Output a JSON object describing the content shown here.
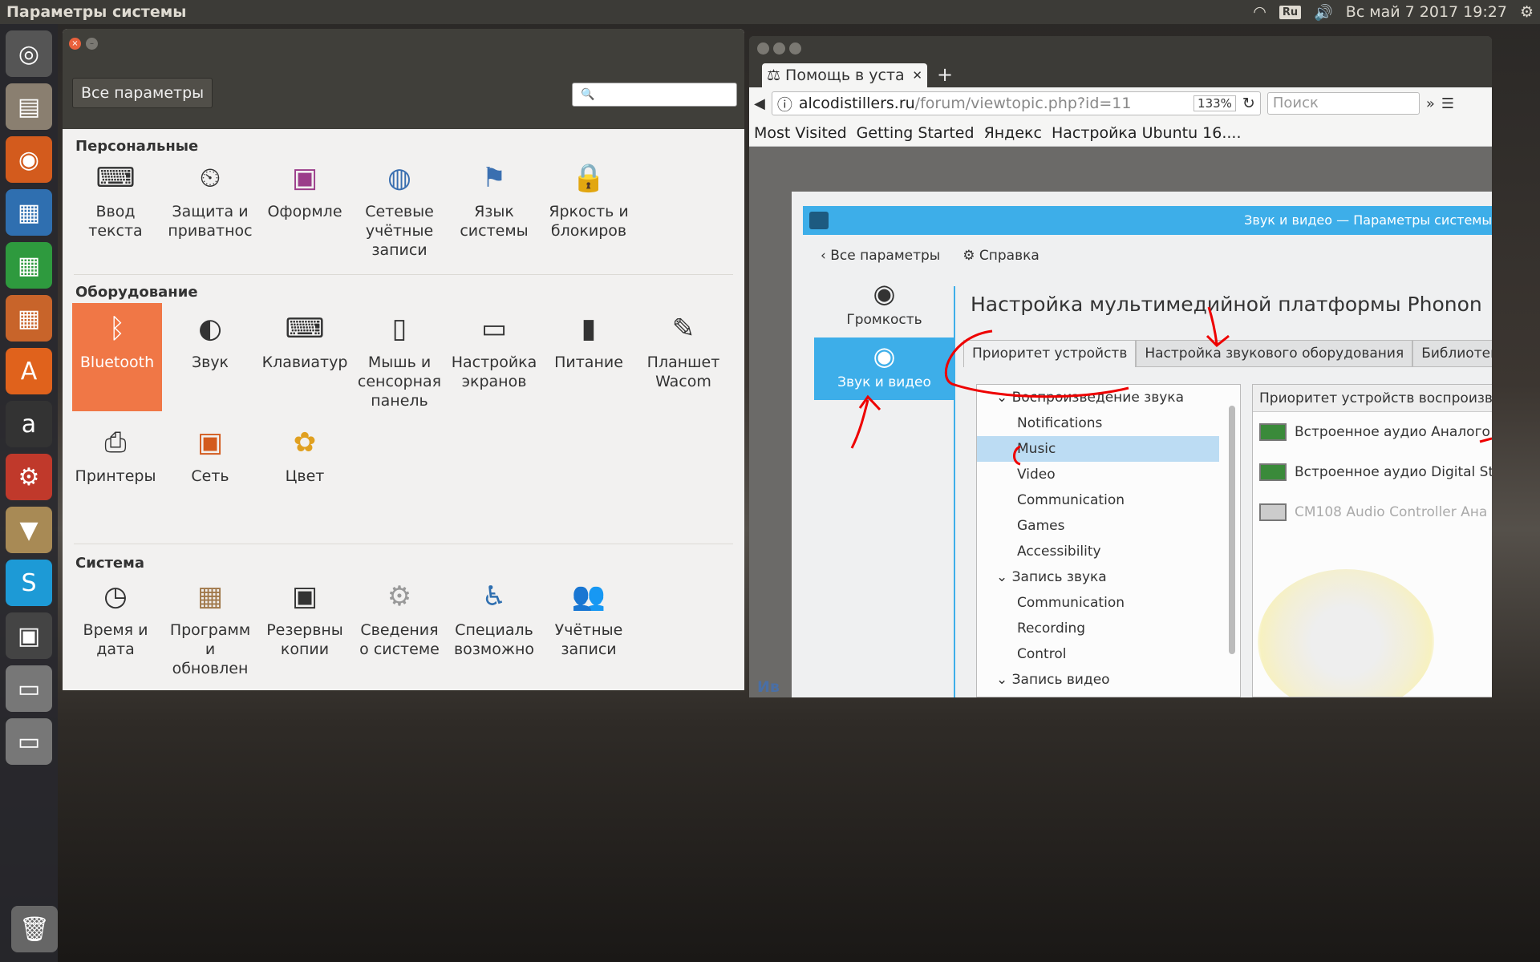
{
  "topbar": {
    "app_title": "Параметры системы",
    "lang": "Ru",
    "datetime": "Вс май  7 2017 19:27"
  },
  "launcher": {
    "items": [
      "ubuntu-icon",
      "files-icon",
      "firefox-icon",
      "writer-icon",
      "calc-icon",
      "impress-icon",
      "software-center-icon",
      "amazon-icon",
      "settings-icon",
      "archive-icon",
      "skype-icon",
      "save-icon",
      "drive-icon",
      "drive-icon"
    ],
    "trash": "trash-icon"
  },
  "settings": {
    "all_button": "Все параметры",
    "sections": {
      "personal": "Персональные",
      "hardware": "Оборудование",
      "system": "Система"
    },
    "personal_items": [
      {
        "label": "Ввод текста",
        "icon": "keyboard-input-icon"
      },
      {
        "label": "Защита и приватнос",
        "icon": "privacy-icon"
      },
      {
        "label": "Оформле",
        "icon": "appearance-icon"
      },
      {
        "label": "Сетевые учётные записи",
        "icon": "online-accounts-icon"
      },
      {
        "label": "Язык системы",
        "icon": "language-icon"
      },
      {
        "label": "Яркость и блокиров",
        "icon": "brightness-lock-icon"
      }
    ],
    "hardware_items": [
      {
        "label": "Bluetooth",
        "icon": "bluetooth-icon"
      },
      {
        "label": "Звук",
        "icon": "sound-icon"
      },
      {
        "label": "Клавиатур",
        "icon": "keyboard-icon"
      },
      {
        "label": "Мышь и сенсорная панель",
        "icon": "mouse-icon"
      },
      {
        "label": "Настройка экранов",
        "icon": "display-icon"
      },
      {
        "label": "Питание",
        "icon": "power-icon"
      },
      {
        "label": "Планшет Wacom",
        "icon": "wacom-icon"
      },
      {
        "label": "Принтеры",
        "icon": "printer-icon"
      },
      {
        "label": "Сеть",
        "icon": "network-icon"
      },
      {
        "label": "Цвет",
        "icon": "color-icon"
      }
    ],
    "system_items": [
      {
        "label": "Время и дата",
        "icon": "clock-icon"
      },
      {
        "label": "Программ и обновлен",
        "icon": "software-updates-icon"
      },
      {
        "label": "Резервны копии",
        "icon": "backup-icon"
      },
      {
        "label": "Сведения о системе",
        "icon": "system-info-icon"
      },
      {
        "label": "Специаль возможно",
        "icon": "accessibility-icon"
      },
      {
        "label": "Учётные записи",
        "icon": "user-accounts-icon"
      }
    ],
    "selected_color": "#f07746"
  },
  "firefox": {
    "tab_title": "Помощь в уста",
    "url_host": "alcodistillers.ru",
    "url_path": "/forum/viewtopic.php?id=11",
    "zoom": "133%",
    "search_placeholder": "Поиск",
    "bookmarks": [
      "Most Visited",
      "Getting Started",
      "Яндекс",
      "Настройка Ubuntu 16...."
    ],
    "footer_text": "Ив"
  },
  "kde": {
    "window_title": "Звук и видео  — Параметры системы",
    "nav_back": "Все параметры",
    "nav_help": "Справка",
    "sidebar": [
      {
        "label": "Громкость",
        "icon": "volume-icon"
      },
      {
        "label": "Звук и видео",
        "icon": "multimedia-icon"
      }
    ],
    "heading": "Настройка мультимедийной платформы Phonon",
    "tabs": [
      "Приоритет устройств",
      "Настройка звукового оборудования",
      "Библиотеки"
    ],
    "tree": [
      {
        "label": "Воспроизведение звука",
        "level": 0
      },
      {
        "label": "Notifications",
        "level": 1
      },
      {
        "label": "Music",
        "level": 1
      },
      {
        "label": "Video",
        "level": 1
      },
      {
        "label": "Communication",
        "level": 1
      },
      {
        "label": "Games",
        "level": 1
      },
      {
        "label": "Accessibility",
        "level": 1
      },
      {
        "label": "Запись звука",
        "level": 0
      },
      {
        "label": "Communication",
        "level": 1
      },
      {
        "label": "Recording",
        "level": 1
      },
      {
        "label": "Control",
        "level": 1
      },
      {
        "label": "Запись видео",
        "level": 0
      }
    ],
    "right_header": "Приоритет устройств воспроизв",
    "devices": [
      {
        "label": "Встроенное аудио Аналого",
        "enabled": true
      },
      {
        "label": "Встроенное аудио Digital St",
        "enabled": true
      },
      {
        "label": "CM108 Audio Controller Ана",
        "enabled": false
      }
    ],
    "accent": "#3daee9"
  }
}
